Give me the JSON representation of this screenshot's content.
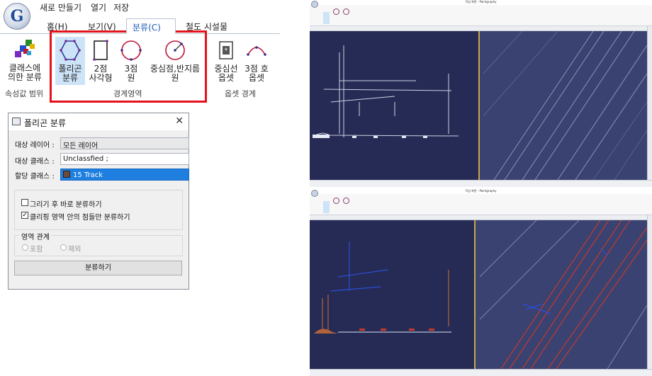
{
  "app": {
    "logo_letter": "G"
  },
  "qat": {
    "new": "새로 만들기",
    "open": "열기",
    "save": "저장"
  },
  "tabs": [
    "홈(H)",
    "보기(V)",
    "분류(C)",
    "철도 시설물"
  ],
  "ribbon": {
    "class_btn": [
      "클래스에",
      "의한 분류"
    ],
    "polygon_btn": [
      "폴리곤",
      "분류"
    ],
    "rect2_btn": [
      "2점",
      "사각형"
    ],
    "circle3_btn": [
      "3점",
      "원"
    ],
    "center_radius_btn": [
      "중심점,반지름",
      "원"
    ],
    "centerline_btn": [
      "중심선",
      "옵셋"
    ],
    "arc3_btn": [
      "3점 호",
      "옵셋"
    ],
    "group_attr": "속성값 범위",
    "group_boundary": "경계영역",
    "group_offset": "옵셋 경계"
  },
  "dialog": {
    "title": "폴리곤 분류",
    "target_layer_label": "대상 레이어 :",
    "target_layer_value": "모든 레이어",
    "target_class_label": "대상 클래스 :",
    "target_class_value": "Unclassfied ;",
    "assign_class_label": "할당 클래스 :",
    "assign_class_value": "15  Track",
    "assign_class_color": "#6b4b3c",
    "opt_classify_after_draw": "그리기 후 바로 분류하기",
    "opt_classify_after_draw_checked": false,
    "opt_clip_only": "클리핑 영역 안의 점들만 분류하기",
    "opt_clip_only_checked": true,
    "region_label": "영역 관계",
    "region_include": "포함",
    "region_exclude": "제외",
    "classify_button": "분류하기"
  },
  "shots": {
    "window_title": "작업 화면 - Pointgraphy"
  },
  "colors": {
    "highlight": "#e3121b",
    "pointcloud_bg": "#2a2f5c",
    "track_red": "#c43a2a",
    "selection_blue": "#1e7fe0"
  }
}
